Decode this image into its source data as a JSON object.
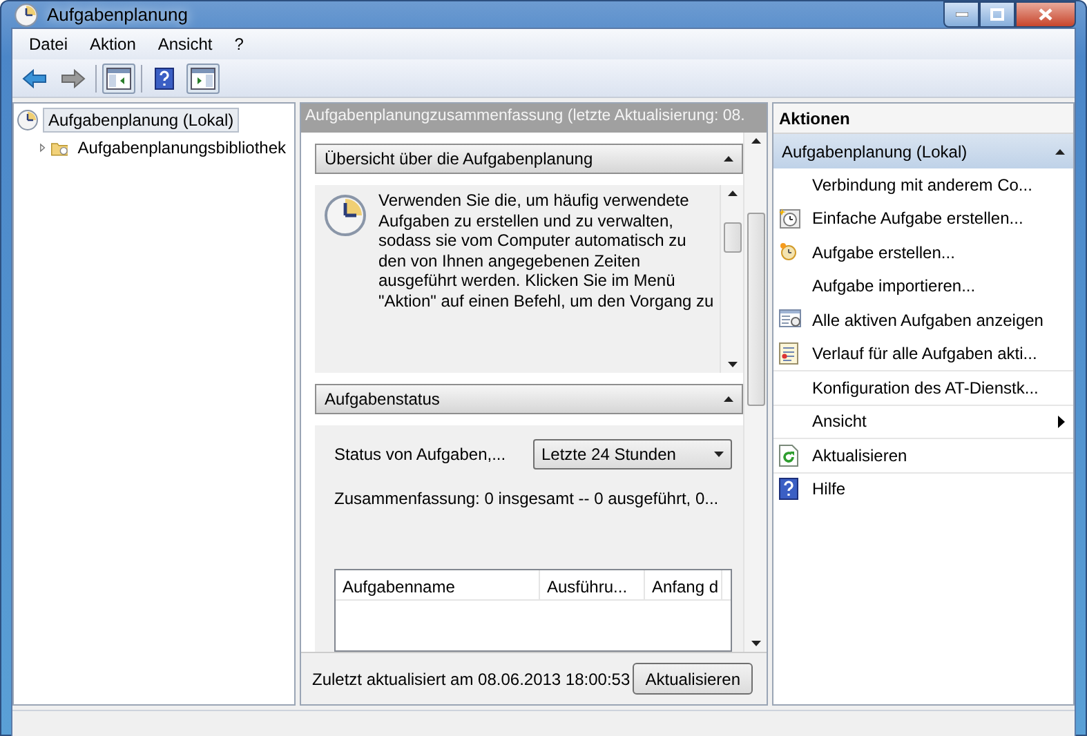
{
  "window": {
    "title": "Aufgabenplanung"
  },
  "menu": [
    "Datei",
    "Aktion",
    "Ansicht",
    "?"
  ],
  "toolbar": [
    {
      "kind": "back",
      "pressed": false
    },
    {
      "kind": "forward",
      "pressed": false
    },
    {
      "kind": "panel-left",
      "pressed": true
    },
    {
      "kind": "help",
      "pressed": false
    },
    {
      "kind": "panel-right",
      "pressed": true
    }
  ],
  "tree": [
    {
      "label": "Aufgabenplanung (Lokal)",
      "selected": true,
      "kind": "clock",
      "children": [
        {
          "label": "Aufgabenplanungsbibliothek",
          "selected": false,
          "expanded": false,
          "kind": "folder"
        }
      ]
    }
  ],
  "summary": {
    "header": "Aufgabenplanungzusammenfassung (letzte Aktualisierung: 08.",
    "overview": {
      "title": "Übersicht über die Aufgabenplanung",
      "expanded": true,
      "text": "Verwenden Sie die, um häufig verwendete Aufgaben zu erstellen und zu verwalten, sodass sie vom Computer automatisch zu den von Ihnen angegebenen Zeiten ausgeführt werden. Klicken Sie im Menü \"Aktion\" auf einen Befehl, um den Vorgang zu"
    },
    "status": {
      "title": "Aufgabenstatus",
      "expanded": true,
      "label": "Status von Aufgaben,...",
      "select": "Letzte 24 Stunden",
      "summary": "Zusammenfassung: 0 insgesamt -- 0 ausgeführt, 0...",
      "columns": [
        "Aufgabenname",
        "Ausführu...",
        "Anfang d"
      ]
    },
    "footer": "Zuletzt aktualisiert am 08.06.2013 18:00:53",
    "refresh_button": "Aktualisieren"
  },
  "actions": {
    "title": "Aktionen",
    "group": "Aufgabenplanung (Lokal)",
    "expanded": true,
    "items": [
      {
        "label": "Verbindung mit anderem Co...",
        "kind": "plain",
        "submenu": false,
        "divider": false
      },
      {
        "label": "Einfache Aufgabe erstellen...",
        "kind": "wizard",
        "submenu": false,
        "divider": false
      },
      {
        "label": "Aufgabe erstellen...",
        "kind": "clock",
        "submenu": false,
        "divider": false
      },
      {
        "label": "Aufgabe importieren...",
        "kind": "plain",
        "submenu": false,
        "divider": false
      },
      {
        "label": "Alle aktiven Aufgaben anzeigen",
        "kind": "list",
        "submenu": false,
        "divider": false
      },
      {
        "label": "Verlauf für alle Aufgaben akti...",
        "kind": "history",
        "submenu": false,
        "divider": true
      },
      {
        "label": "Konfiguration des AT-Dienstk...",
        "kind": "plain",
        "submenu": false,
        "divider": true
      },
      {
        "label": "Ansicht",
        "kind": "plain",
        "submenu": true,
        "divider": true
      },
      {
        "label": "Aktualisieren",
        "kind": "refresh",
        "submenu": false,
        "divider": true
      },
      {
        "label": "Hilfe",
        "kind": "help",
        "submenu": false,
        "divider": false
      }
    ]
  }
}
